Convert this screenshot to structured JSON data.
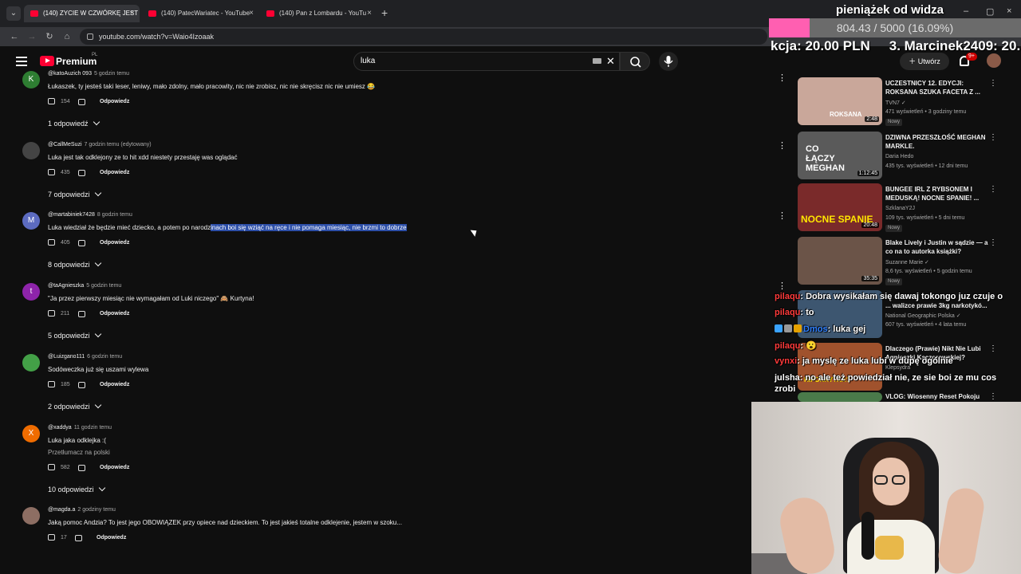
{
  "browser": {
    "tabs": [
      {
        "label": "(140) ZYCIE W CZWÓRKĘ JEST"
      },
      {
        "label": "(140) PatecWariatec - YouTube"
      },
      {
        "label": "(140) Pan z Lombardu - YouTu"
      }
    ],
    "url": "youtube.com/watch?v=Waio4Izoaak",
    "new_tab": "+"
  },
  "header": {
    "logo_text": "Premium",
    "logo_region": "PL",
    "search_value": "luka",
    "create_label": "Utwórz",
    "notifications_badge": "9+"
  },
  "comments": [
    {
      "author": "@katoAuzich 093",
      "time": "5 godzin temu",
      "avatar_letter": "K",
      "avatar_color": "#2e7d32",
      "text": "Łukaszek, ty jesteś taki leser, leniwy, mało zdolny, mało pracowity, nic nie zrobisz, nic nie skręcisz nic nie umiesz 😂",
      "likes": "154",
      "reply_label": "Odpowiedz",
      "replies": "1 odpowiedź"
    },
    {
      "author": "@CallMeSuzi",
      "time": "7 godzin temu (edytowany)",
      "avatar_letter": "",
      "avatar_color": "#444444",
      "text": "Luka jest tak odklejony ze to hit xdd niestety przestaję was oglądać",
      "likes": "435",
      "reply_label": "Odpowiedz",
      "replies": "7 odpowiedzi"
    },
    {
      "author": "@martabiniek7428",
      "time": "8 godzin temu",
      "avatar_letter": "M",
      "avatar_color": "#5c6bc0",
      "text_plain": "Luka wiedział że będzie mieć dziecko, a potem po narodz",
      "text_highlight": "inach boi się wziąć na ręce i nie pomaga miesiąc, nie brzmi to dobrze",
      "likes": "405",
      "reply_label": "Odpowiedz",
      "replies": "8 odpowiedzi"
    },
    {
      "author": "@taAgnieszka",
      "time": "5 godzin temu",
      "avatar_letter": "t",
      "avatar_color": "#8e24aa",
      "text": "\"Ja przez pierwszy miesiąc nie wymagałam od Luki niczego\" 🙈 Kurtyna!",
      "likes": "211",
      "reply_label": "Odpowiedz",
      "replies": "5 odpowiedzi"
    },
    {
      "author": "@Luizgano111",
      "time": "6 godzin temu",
      "avatar_letter": "",
      "avatar_color": "#43a047",
      "text": "Sodóweczka już się uszami wylewa",
      "likes": "185",
      "reply_label": "Odpowiedz",
      "replies": "2 odpowiedzi"
    },
    {
      "author": "@xaddya",
      "time": "11 godzin temu",
      "avatar_letter": "X",
      "avatar_color": "#ef6c00",
      "text": "Luka jaka odklejka :(",
      "translate": "Przetłumacz na polski",
      "likes": "582",
      "reply_label": "Odpowiedz",
      "replies": "10 odpowiedzi"
    },
    {
      "author": "@magda.a",
      "time": "2 godziny temu",
      "avatar_letter": "",
      "avatar_color": "#8d6e63",
      "text": "Jaką pomoc Andzia? To jest jego OBOWIĄZEK przy opiece nad dzieckiem. To jest jakieś totalne  odklejenie, jestem w szoku...",
      "likes": "17",
      "reply_label": "Odpowiedz"
    }
  ],
  "recommendations": [
    {
      "title": "UCZESTNICY 12. EDYCJI: ROKSANA SZUKA FACETA Z ...",
      "channel": "TVN7 ✓",
      "meta": "471 wyświetleń • 3 godziny temu",
      "badge": "Nowy",
      "duration": "2:48",
      "thumb_label": "ROKSANA",
      "thumb_color": "#c9a79a"
    },
    {
      "title": "DZIWNA PRZESZŁOŚĆ MEGHAN MARKLE.",
      "channel": "Daria Hedo",
      "meta": "435 tys. wyświetleń • 12 dni temu",
      "badge": "",
      "duration": "1:12:45",
      "thumb_label": "CO ŁĄCZY MEGHAN",
      "thumb_color": "#5a5a5a"
    },
    {
      "title": "BUNGEE IRL Z RYBSONEM I MEDUSKĄ! NOCNE SPANIE! ...",
      "channel": "SzklanaY2J",
      "meta": "109 tys. wyświetleń • 5 dni temu",
      "badge": "Nowy",
      "duration": "20:48",
      "thumb_label": "NOCNE SPANIE",
      "thumb_color": "#7a2a2a"
    },
    {
      "title": "Blake Lively i Justin w sądzie — a co na to autorka książki?",
      "channel": "Suzanne Marie ✓",
      "meta": "8,6 tys. wyświetleń • 5 godzin temu",
      "badge": "Nowy",
      "duration": "35:35",
      "thumb_label": "",
      "thumb_color": "#6b5448"
    },
    {
      "title": "... walizce prawie 3kg narkotykó...",
      "channel": "National Geographic Polska ✓",
      "meta": "607 tys. wyświetleń • 4 lata temu",
      "badge": "",
      "duration": "",
      "thumb_label": "",
      "thumb_color": "#3d5670"
    },
    {
      "title": "Dlaczego (Prawie) Nikt Nie Lubi Agnieszki Kaczorowskiej?",
      "channel": "Klepsydra",
      "meta": "",
      "badge": "",
      "duration": "",
      "thumb_label": "HIPOKRYTKA?",
      "thumb_color": "#a0522d"
    },
    {
      "title": "VLOG: Wiosenny Reset Pokoju",
      "channel": "",
      "meta": "",
      "badge": "",
      "duration": "",
      "thumb_label": "",
      "thumb_color": "#4a7a4a"
    }
  ],
  "stream": {
    "donation_title": "pieniążek od widza",
    "donation_progress": "804.43 / 5000 (16.09%)",
    "donation_fraction": 0.1609,
    "ticker_1": "kcja: 20.00 PLN",
    "ticker_2": "3. Marcinek2409: 20.",
    "chat": [
      {
        "user": "pilaqu",
        "text": ": Dobra wysikałam się dawaj tokongo juz czuje o",
        "user_color": "red"
      },
      {
        "user": "pilaqu",
        "text": ": to",
        "user_color": "red"
      },
      {
        "user": "Dmos",
        "text": ": luka gej",
        "user_color": "blue"
      },
      {
        "user": "pilaqu",
        "text": ": 😮",
        "user_color": "red"
      },
      {
        "user": "vynxi",
        "text": ": ja myslę ze luka lubi w dupę ogólnie",
        "user_color": "red"
      },
      {
        "user": "julsha",
        "text": ": no ale też powiedział nie, ze sie boi ze mu cos zrobi",
        "user_color": "white"
      }
    ]
  }
}
